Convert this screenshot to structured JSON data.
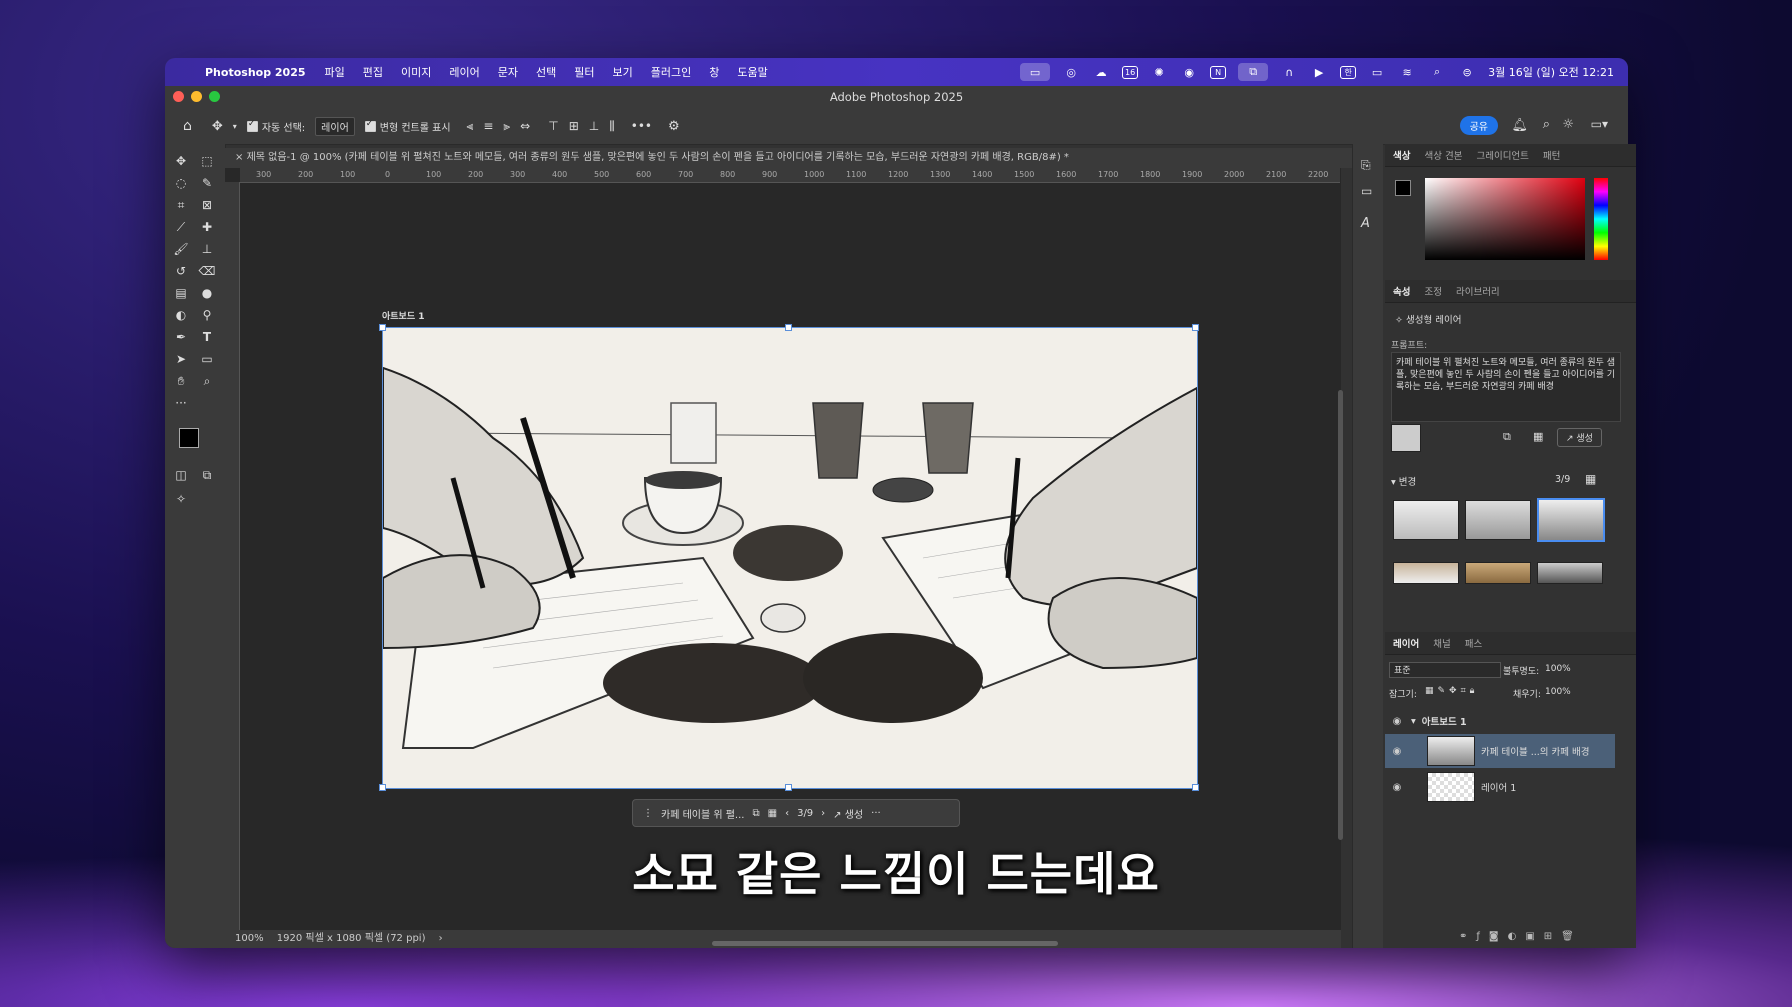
{
  "menubar": {
    "app_name": "Photoshop 2025",
    "items": [
      "파일",
      "편집",
      "이미지",
      "레이어",
      "문자",
      "선택",
      "필터",
      "보기",
      "플러그인",
      "창",
      "도움말"
    ],
    "datetime": "3월 16일 (일) 오전 12:21"
  },
  "window": {
    "title": "Adobe Photoshop 2025"
  },
  "options": {
    "auto_select_label": "자동 선택:",
    "auto_select_value": "레이어",
    "transform_label": "변형 컨트롤 표시",
    "share_label": "공유"
  },
  "document": {
    "tab_title": "제목 없음-1 @ 100% (카페 테이블 위 펼쳐진 노트와 메모들, 여러 종류의 원두 샘플, 맞은편에 놓인 두 사람의 손이 펜을 들고 아이디어를 기록하는 모습, 부드러운 자연광의 카페 배경, RGB/8#) *",
    "artboard_label": "아트보드 1",
    "ruler_ticks": [
      "300",
      "200",
      "100",
      "0",
      "100",
      "200",
      "300",
      "400",
      "500",
      "600",
      "700",
      "800",
      "900",
      "1000",
      "1100",
      "1200",
      "1300",
      "1400",
      "1500",
      "1600",
      "1700",
      "1800",
      "1900",
      "2000",
      "2100",
      "2200"
    ]
  },
  "context_bar": {
    "prompt_short": "카페 테이블 위 펼...",
    "page": "3/9",
    "generate_label": "생성"
  },
  "subtitle": "소묘 같은 느낌이 드는데요",
  "status": {
    "zoom": "100%",
    "dimensions": "1920 픽셀 x 1080 픽셀 (72 ppi)"
  },
  "color_panel": {
    "tabs": [
      "색상",
      "색상 견본",
      "그레이디언트",
      "패턴"
    ]
  },
  "properties_panel": {
    "tabs": [
      "속성",
      "조정",
      "라이브러리"
    ],
    "layer_type": "생성형 레이어",
    "prompt_label": "프롬프트:",
    "prompt_text": "카페 테이블 위 펼쳐진 노트와 메모들, 여러 종류의 원두 샘플, 맞은편에 놓인 두 사람의 손이 펜을 들고 아이디어를 기록하는 모습, 부드러운 자연광의 카페 배경",
    "generate_label": "생성",
    "variations_label": "변경",
    "variations_count": "3/9"
  },
  "layers_panel": {
    "tabs": [
      "레이어",
      "채널",
      "패스"
    ],
    "blend_mode": "표준",
    "opacity_label": "불투명도:",
    "opacity": "100%",
    "lock_label": "잠그기:",
    "fill_label": "채우기:",
    "fill": "100%",
    "group_name": "아트보드 1",
    "layers": [
      {
        "name": "카페 테이블 ...의 카페 배경"
      },
      {
        "name": "레이어 1"
      }
    ]
  }
}
